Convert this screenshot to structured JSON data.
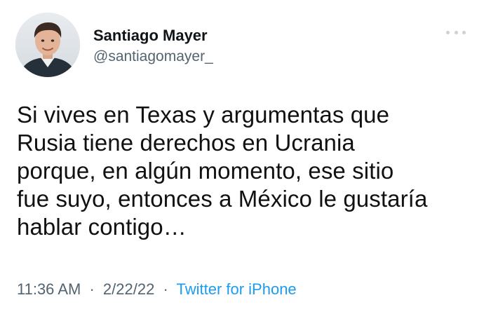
{
  "tweet": {
    "author": {
      "display_name": "Santiago Mayer",
      "handle": "@santiagomayer_",
      "avatar_icon": "profile-photo"
    },
    "more_icon": "more-options-icon",
    "text": "Si vives en Texas y argumentas que\nRusia tiene derechos en Ucrania\nporque, en algún momento, ese sitio\nfue suyo, entonces a México le gustaría\nhablar contigo…",
    "time": "11:36 AM",
    "separator": "·",
    "date": "2/22/22",
    "source": "Twitter for iPhone",
    "colors": {
      "link": "#1d9bf0",
      "secondary_text": "#536471"
    }
  }
}
